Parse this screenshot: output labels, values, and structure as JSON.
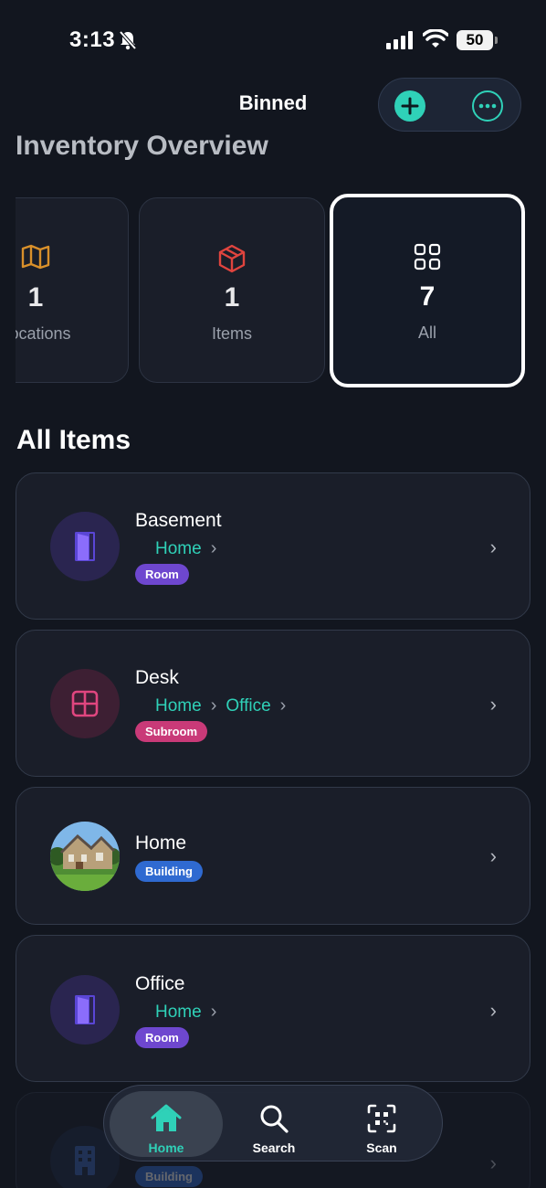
{
  "status": {
    "time": "3:13",
    "battery": "50"
  },
  "nav": {
    "title": "Binned",
    "add_icon": "plus-icon",
    "more_icon": "ellipsis-icon"
  },
  "overview": {
    "title": "Inventory Overview",
    "cards": [
      {
        "count": "1",
        "label": "Locations",
        "icon": "map-icon",
        "color": "#d9902a"
      },
      {
        "count": "1",
        "label": "Items",
        "icon": "box-icon",
        "color": "#e0443e"
      },
      {
        "count": "7",
        "label": "All",
        "icon": "grid-icon",
        "color": "#ffffff"
      }
    ]
  },
  "all_items": {
    "title": "All Items",
    "rows": [
      {
        "name": "Basement",
        "crumbs": [
          "Home"
        ],
        "badge": "Room",
        "badge_color": "#6e47cf",
        "icon": "door-icon"
      },
      {
        "name": "Desk",
        "crumbs": [
          "Home",
          "Office"
        ],
        "badge": "Subroom",
        "badge_color": "#c93a78",
        "icon": "grid-square-icon"
      },
      {
        "name": "Home",
        "crumbs": [],
        "badge": "Building",
        "badge_color": "#2f6ad1",
        "icon": "house-photo"
      },
      {
        "name": "Office",
        "crumbs": [
          "Home"
        ],
        "badge": "Room",
        "badge_color": "#6e47cf",
        "icon": "door-icon"
      },
      {
        "name": "",
        "crumbs": [],
        "badge": "Building",
        "badge_color": "#2f6ad1",
        "icon": "building-icon"
      }
    ]
  },
  "tabs": [
    {
      "label": "Home",
      "icon": "house-icon",
      "active": true
    },
    {
      "label": "Search",
      "icon": "search-icon",
      "active": false
    },
    {
      "label": "Scan",
      "icon": "qr-scan-icon",
      "active": false
    }
  ],
  "colors": {
    "accent": "#2fd1b8",
    "background": "#12161f",
    "card": "#1a1e29"
  }
}
